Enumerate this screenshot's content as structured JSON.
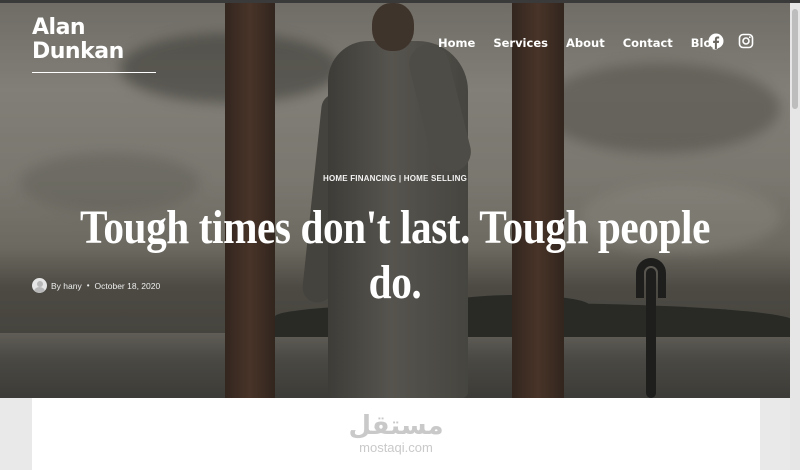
{
  "brand": {
    "name": "Alan Dunkan"
  },
  "nav": {
    "items": [
      "Home",
      "Services",
      "About",
      "Contact",
      "Blog"
    ]
  },
  "social": {
    "icons": [
      "facebook-icon",
      "instagram-icon"
    ]
  },
  "post": {
    "categories": "HOME FINANCING | HOME SELLING",
    "title": "Tough times don't last. Tough people do.",
    "author": "By hany",
    "separator": "•",
    "date": "October 18, 2020"
  },
  "watermark": {
    "arabic": "مستقل",
    "latin": "mostaqi.com"
  },
  "colors": {
    "text_on_hero": "#ffffff",
    "content_bg": "#ffffff",
    "watermark": "#c9c9c9"
  }
}
